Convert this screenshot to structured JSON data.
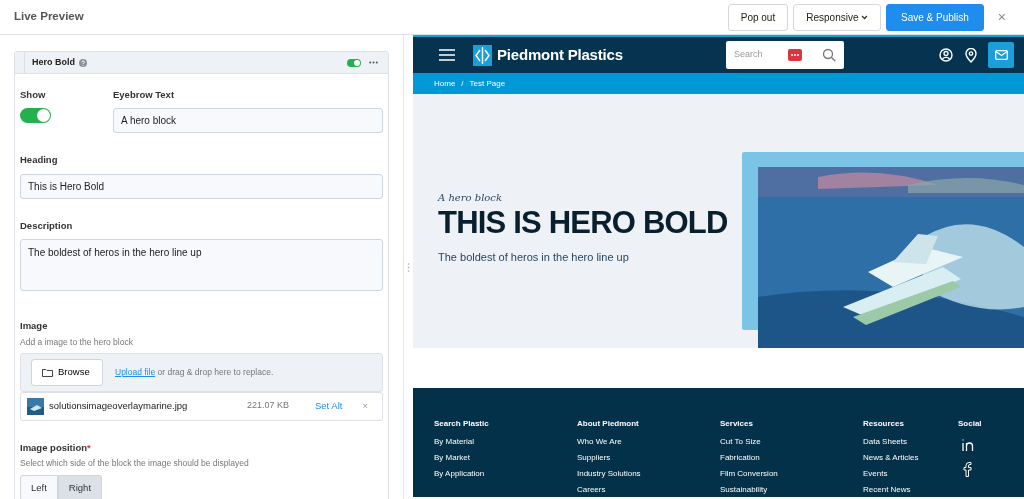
{
  "topbar": {
    "title": "Live Preview",
    "buttons": [
      {
        "label": "Pop out",
        "kind": "plain"
      },
      {
        "label": "Responsive",
        "kind": "dropdown"
      },
      {
        "label": "Save & Publish",
        "kind": "primary"
      }
    ],
    "close": "×"
  },
  "editor": {
    "block": {
      "title": "Hero Bold",
      "enabled": true
    },
    "show": {
      "label": "Show",
      "on": true
    },
    "fields": [
      {
        "label": "Eyebrow Text",
        "value": "A hero block",
        "kind": "input"
      },
      {
        "label": "Heading",
        "value": "This is Hero Bold",
        "kind": "input"
      },
      {
        "label": "Description",
        "value": "The boldest of heros in the hero line up",
        "kind": "textarea"
      }
    ],
    "image": {
      "label": "Image",
      "help": "Add a image to the hero block",
      "browse": "Browse",
      "upload_link": "Upload file",
      "upload_text": "or drag & drop here to replace.",
      "file": {
        "name": "solutionsimageoverlaymarine.jpg",
        "size": "221.07 KB",
        "set_alt": "Set Alt",
        "remove": "×"
      }
    },
    "position": {
      "label": "Image position",
      "required": true,
      "required_mark": "*",
      "help": "Select which side of the block the image should be displayed",
      "options": [
        {
          "label": "Left",
          "selected": false
        },
        {
          "label": "Right",
          "selected": true
        }
      ]
    }
  },
  "preview": {
    "brand": "Piedmont Plastics",
    "search_placeholder": "Search",
    "breadcrumb": [
      "Home",
      "Test Page"
    ],
    "breadcrumb_separator": "/",
    "hero": {
      "eyebrow": "A hero block",
      "heading": "THIS IS HERO BOLD",
      "description": "The boldest of heros in the hero line up"
    },
    "footer": [
      {
        "heading": "Search Plastic",
        "links": [
          "By Material",
          "By Market",
          "By Application"
        ]
      },
      {
        "heading": "About Piedmont",
        "links": [
          "Who We Are",
          "Suppliers",
          "Industry Solutions",
          "Careers"
        ]
      },
      {
        "heading": "Services",
        "links": [
          "Cut To Size",
          "Fabrication",
          "Film Conversion",
          "Sustainability"
        ]
      },
      {
        "heading": "Resources",
        "links": [
          "Data Sheets",
          "News & Articles",
          "Events",
          "Recent News"
        ]
      },
      {
        "heading": "Social",
        "kind": "social"
      }
    ]
  }
}
